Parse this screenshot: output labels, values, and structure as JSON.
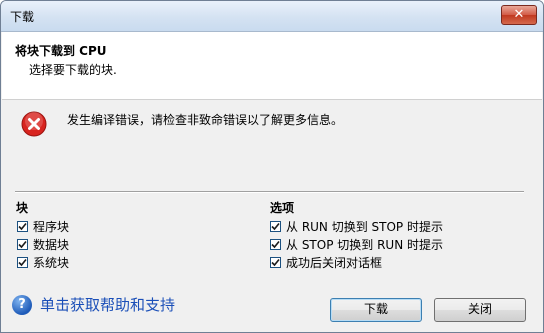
{
  "window": {
    "title": "下载",
    "close_symbol": "✕"
  },
  "header": {
    "title": "将块下载到 CPU",
    "subtitle": "选择要下载的块."
  },
  "message": {
    "icon": "error-icon",
    "text": "发生编译错误，请检查非致命错误以了解更多信息。"
  },
  "blocks_group": {
    "title": "块",
    "items": [
      {
        "label": "程序块",
        "checked": true
      },
      {
        "label": "数据块",
        "checked": true
      },
      {
        "label": "系统块",
        "checked": true
      }
    ]
  },
  "options_group": {
    "title": "选项",
    "items": [
      {
        "label": "从 RUN 切换到 STOP 时提示",
        "checked": true
      },
      {
        "label": "从 STOP 切换到 RUN 时提示",
        "checked": true
      },
      {
        "label": "成功后关闭对话框",
        "checked": true
      }
    ]
  },
  "help": {
    "icon": "help-icon",
    "text": "单击获取帮助和支持",
    "color": "#1b4fb8"
  },
  "buttons": {
    "download": "下载",
    "close": "关闭"
  },
  "colors": {
    "error_red": "#d8241f",
    "title_bar": "#d4e2f2"
  }
}
